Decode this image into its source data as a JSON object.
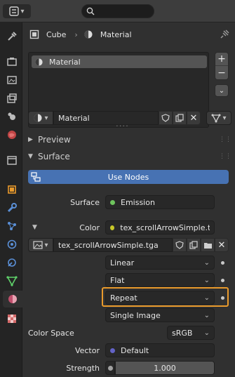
{
  "header": {
    "search_placeholder": ""
  },
  "breadcrumb": {
    "object": "Cube",
    "material": "Material"
  },
  "slots": {
    "items": [
      {
        "label": "Material"
      }
    ]
  },
  "material_field": {
    "value": "Material"
  },
  "sections": {
    "preview": "Preview",
    "surface": "Surface"
  },
  "use_nodes_label": "Use Nodes",
  "surface_row": {
    "label": "Surface",
    "value": "Emission"
  },
  "color_row": {
    "label": "Color",
    "value": "tex_scrollArrowSimple.tga"
  },
  "image_field": {
    "value": "tex_scrollArrowSimple.tga"
  },
  "interpolation": {
    "value": "Linear"
  },
  "projection": {
    "value": "Flat"
  },
  "extension": {
    "value": "Repeat"
  },
  "source": {
    "value": "Single Image"
  },
  "color_space": {
    "label": "Color Space",
    "value": "sRGB"
  },
  "vector": {
    "label": "Vector",
    "value": "Default"
  },
  "strength": {
    "label": "Strength",
    "value": "1.000"
  },
  "colors": {
    "accent": "#4772b3",
    "highlight": "#e99a2c",
    "emission_socket": "#6ec45d",
    "color_socket": "#c7c729",
    "vector_socket": "#6363c7"
  }
}
